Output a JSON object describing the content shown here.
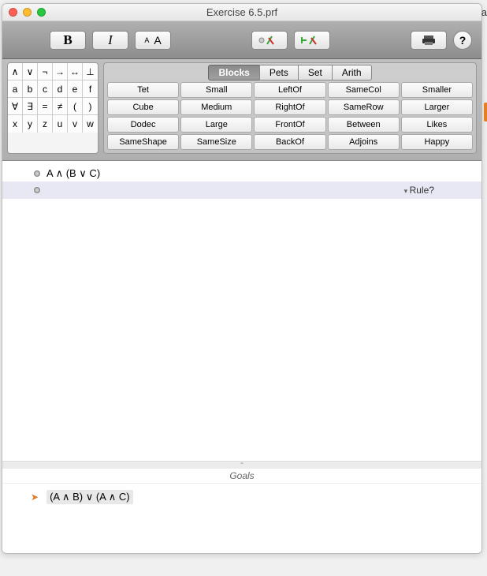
{
  "titlebar": {
    "title": "Exercise 6.5.prf"
  },
  "sidetext": "Ga",
  "toolbar": {
    "bold": "B",
    "italic": "I",
    "size_small": "A",
    "size_large": "A"
  },
  "symbols": {
    "rows": [
      [
        "∧",
        "∨",
        "¬",
        "→",
        "↔",
        "⊥"
      ],
      [
        "a",
        "b",
        "c",
        "d",
        "e",
        "f"
      ],
      [
        "∀",
        "∃",
        "=",
        "≠",
        "(",
        ")"
      ],
      [
        "x",
        "y",
        "z",
        "u",
        "v",
        "w"
      ]
    ]
  },
  "tabs": [
    "Blocks",
    "Pets",
    "Set",
    "Arith"
  ],
  "tabs_selected": 0,
  "predicates": [
    [
      "Tet",
      "Small",
      "LeftOf",
      "SameCol",
      "Smaller"
    ],
    [
      "Cube",
      "Medium",
      "RightOf",
      "SameRow",
      "Larger"
    ],
    [
      "Dodec",
      "Large",
      "FrontOf",
      "Between",
      "Likes"
    ],
    [
      "SameShape",
      "SameSize",
      "BackOf",
      "Adjoins",
      "Happy"
    ]
  ],
  "proof": {
    "lines": [
      {
        "text": "A ∧ (B ∨ C)"
      }
    ],
    "rule_prompt": "Rule?"
  },
  "goals": {
    "header": "Goals",
    "items": [
      {
        "text": "(A ∧ B) ∨ (A ∧ C)"
      }
    ]
  }
}
